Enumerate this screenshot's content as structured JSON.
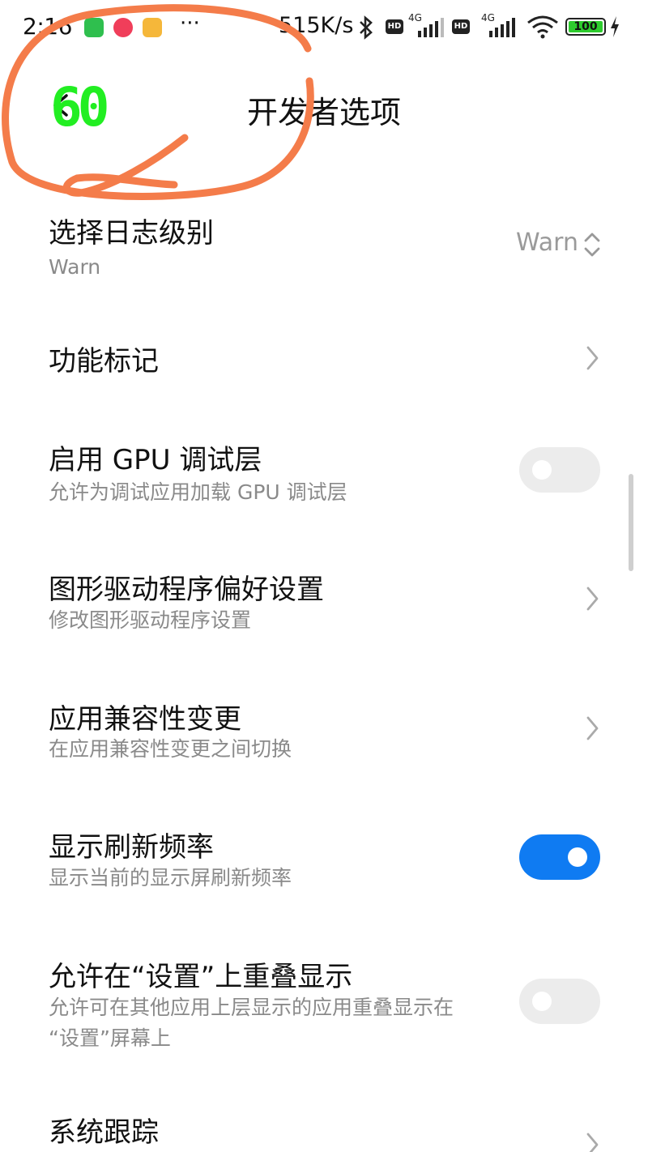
{
  "status_bar": {
    "time": "2:16",
    "more": "···",
    "net_speed": "515K/s",
    "hd_label": "HD",
    "network_type": "4G",
    "battery": "100"
  },
  "header": {
    "fps_value": "60",
    "title": "开发者选项"
  },
  "items": [
    {
      "title": "选择日志级别",
      "subtitle": "Warn",
      "value": "Warn",
      "control": "dropdown"
    },
    {
      "title": "功能标记",
      "control": "chevron"
    },
    {
      "title": "启用 GPU 调试层",
      "subtitle": "允许为调试应用加载 GPU 调试层",
      "control": "toggle",
      "enabled": false
    },
    {
      "title": "图形驱动程序偏好设置",
      "subtitle": "修改图形驱动程序设置",
      "control": "chevron"
    },
    {
      "title": "应用兼容性变更",
      "subtitle": "在应用兼容性变更之间切换",
      "control": "chevron"
    },
    {
      "title": "显示刷新频率",
      "subtitle": "显示当前的显示屏刷新频率",
      "control": "toggle",
      "enabled": true
    },
    {
      "title": "允许在“设置”上重叠显示",
      "subtitle_line1": "允许可在其他应用上层显示的应用重叠显示在",
      "subtitle_line2": "“设置”屏幕上",
      "control": "toggle",
      "enabled": false
    },
    {
      "title": "系统跟踪",
      "control": "chevron"
    }
  ],
  "colors": {
    "accent": "#0f7bf2",
    "toggle_off": "#ececec",
    "fps_overlay": "#22ee22",
    "annotation": "#f47c4a"
  }
}
